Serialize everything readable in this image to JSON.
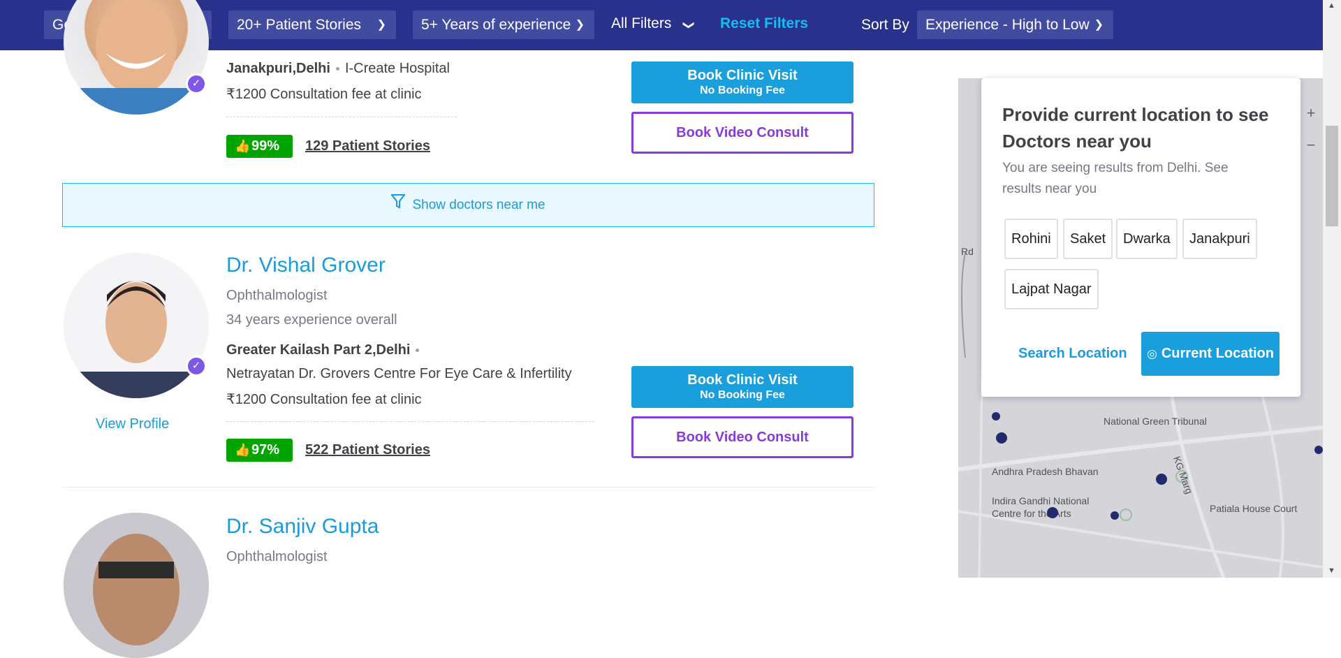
{
  "filters": {
    "gender": "Gender",
    "stories": "20+ Patient Stories",
    "experience": "5+ Years of experience",
    "all_filters": "All Filters",
    "reset": "Reset Filters",
    "sort_label": "Sort By",
    "sort_value": "Experience - High to Low"
  },
  "card1": {
    "location": "Janakpuri,Delhi",
    "clinic": "I-Create Hospital",
    "fee": "₹1200 Consultation fee at clinic",
    "rating": "99%",
    "stories": "129 Patient Stories"
  },
  "near_me": "Show doctors near me",
  "card2": {
    "name": "Dr. Vishal Grover",
    "specialty": "Ophthalmologist",
    "experience": "34 years experience overall",
    "location": "Greater Kailash Part 2,Delhi",
    "clinic": "Netrayatan Dr. Grovers Centre For Eye Care & Infertility",
    "fee": "₹1200 Consultation fee at clinic",
    "rating": "97%",
    "stories": "522 Patient Stories",
    "view_profile": "View Profile"
  },
  "card3": {
    "name": "Dr. Sanjiv Gupta",
    "specialty": "Ophthalmologist"
  },
  "buttons": {
    "clinic": "Book Clinic Visit",
    "clinic_sub": "No Booking Fee",
    "video": "Book Video Consult"
  },
  "popup": {
    "title": "Provide current location to see Doctors near you",
    "subtitle": "You are seeing results from Delhi. See results near you",
    "chips": [
      "Rohini",
      "Saket",
      "Dwarka",
      "Janakpuri",
      "Lajpat Nagar"
    ],
    "search_location": "Search Location",
    "current_location": "Current Location"
  },
  "map": {
    "labels": [
      "National Green Tribunal",
      "Andhra Pradesh Bhavan",
      "Indira Gandhi National",
      "Centre for the Arts",
      "Patiala House Court",
      "KG Marg",
      "Rd"
    ]
  },
  "colors": {
    "filter_bar": "#28328c",
    "primary_blue": "#1a9fdc",
    "video_purple": "#8a3ad6",
    "rating_green": "#01a400"
  }
}
